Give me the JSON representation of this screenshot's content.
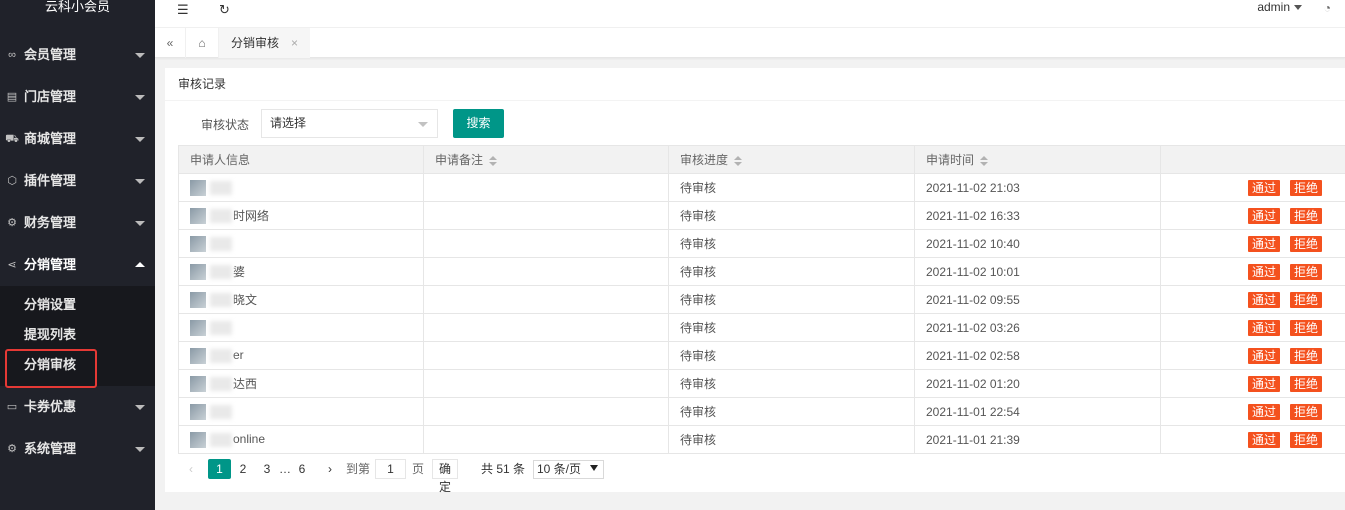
{
  "app": {
    "title": "云科小会员"
  },
  "sidebar": {
    "menu": [
      {
        "label": "会员管理",
        "icon": "members-icon",
        "glyph": "∞"
      },
      {
        "label": "门店管理",
        "icon": "store-icon",
        "glyph": "▤"
      },
      {
        "label": "商城管理",
        "icon": "cart-icon",
        "glyph": "⛟"
      },
      {
        "label": "插件管理",
        "icon": "plugin-icon",
        "glyph": "⬡"
      },
      {
        "label": "财务管理",
        "icon": "finance-icon",
        "glyph": "⚙"
      },
      {
        "label": "分销管理",
        "icon": "share-icon",
        "glyph": "⋖"
      },
      {
        "label": "卡券优惠",
        "icon": "coupon-icon",
        "glyph": "▭"
      },
      {
        "label": "系统管理",
        "icon": "settings-icon",
        "glyph": "⚙"
      }
    ],
    "submenu": [
      "分销设置",
      "提现列表",
      "分销审核"
    ]
  },
  "header": {
    "username": "admin"
  },
  "tabs": {
    "active_label": "分销审核"
  },
  "card": {
    "title": "审核记录"
  },
  "filter": {
    "label": "审核状态",
    "select_value": "请选择",
    "search_label": "搜索"
  },
  "table": {
    "headers": [
      "申请人信息",
      "申请备注",
      "审核进度",
      "申请时间",
      ""
    ],
    "rows": [
      {
        "name": "",
        "remark": "",
        "status": "待审核",
        "time": "2021-11-02 21:03"
      },
      {
        "name": "时网络",
        "remark": "",
        "status": "待审核",
        "time": "2021-11-02 16:33"
      },
      {
        "name": "",
        "remark": "",
        "status": "待审核",
        "time": "2021-11-02 10:40"
      },
      {
        "name": "婆",
        "remark": "",
        "status": "待审核",
        "time": "2021-11-02 10:01"
      },
      {
        "name": "晓文",
        "remark": "",
        "status": "待审核",
        "time": "2021-11-02 09:55"
      },
      {
        "name": "",
        "remark": "",
        "status": "待审核",
        "time": "2021-11-02 03:26"
      },
      {
        "name": "er",
        "remark": "",
        "status": "待审核",
        "time": "2021-11-02 02:58"
      },
      {
        "name": "达西",
        "remark": "",
        "status": "待审核",
        "time": "2021-11-02 01:20"
      },
      {
        "name": "",
        "remark": "",
        "status": "待审核",
        "time": "2021-11-01 22:54"
      },
      {
        "name": "online",
        "remark": "",
        "status": "待审核",
        "time": "2021-11-01 21:39"
      }
    ],
    "pass_label": "通过",
    "reject_label": "拒绝"
  },
  "pagination": {
    "prev": "‹",
    "pages": [
      "1",
      "2",
      "3"
    ],
    "ellipsis": "…",
    "last": "6",
    "next": "›",
    "goto_label": "到第",
    "goto_value": "1",
    "page_label": "页",
    "confirm_label": "确定",
    "total_label": "共 51 条",
    "page_size": "10 条/页"
  }
}
